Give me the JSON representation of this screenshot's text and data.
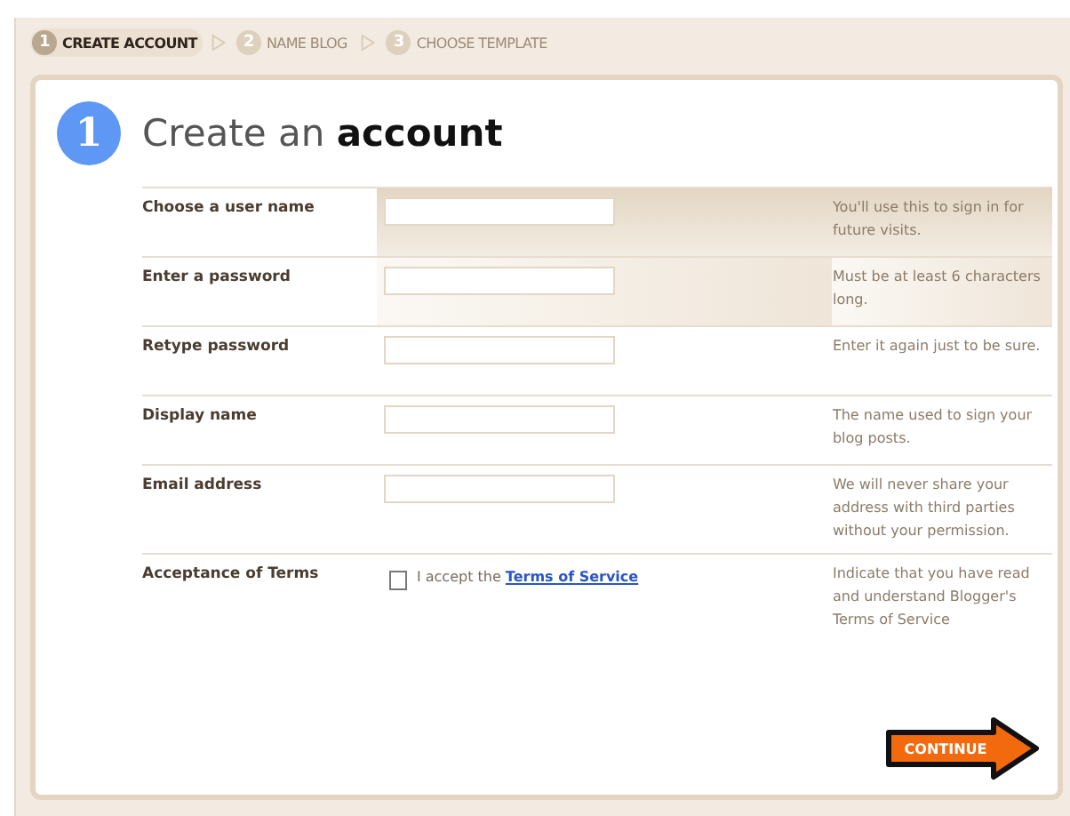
{
  "steps": [
    {
      "number": "1",
      "label": "CREATE ACCOUNT",
      "selected": true
    },
    {
      "number": "2",
      "label": "NAME BLOG",
      "selected": false
    },
    {
      "number": "3",
      "label": "CHOOSE TEMPLATE",
      "selected": false
    }
  ],
  "heading": {
    "number": "1",
    "text": "Create an **account**"
  },
  "rows": [
    {
      "kind": "text",
      "label": "Choose a user name",
      "hint": "You'll use this to sign in for future visits.",
      "highlighted": true
    },
    {
      "kind": "text",
      "label": "Enter a password",
      "hint": "Must be at least 6 characters long.",
      "highlighted": true
    },
    {
      "kind": "text",
      "label": "Retype password",
      "hint": "Enter it again just to be sure.",
      "highlighted": false
    },
    {
      "kind": "text",
      "label": "Display name",
      "hint": "The name used to sign your blog posts.",
      "highlighted": false
    },
    {
      "kind": "text",
      "label": "Email address",
      "hint": "We will never share your address with third parties without your permission.",
      "highlighted": false
    },
    {
      "kind": "checkbox",
      "label": "Acceptance of Terms",
      "checkbox_text": "I accept the",
      "link": "Terms of Service",
      "checked": false,
      "hint": "Indicate that you have read and understand Blogger's Terms of Service",
      "highlighted": false
    }
  ],
  "continue_button": "CONTINUE"
}
